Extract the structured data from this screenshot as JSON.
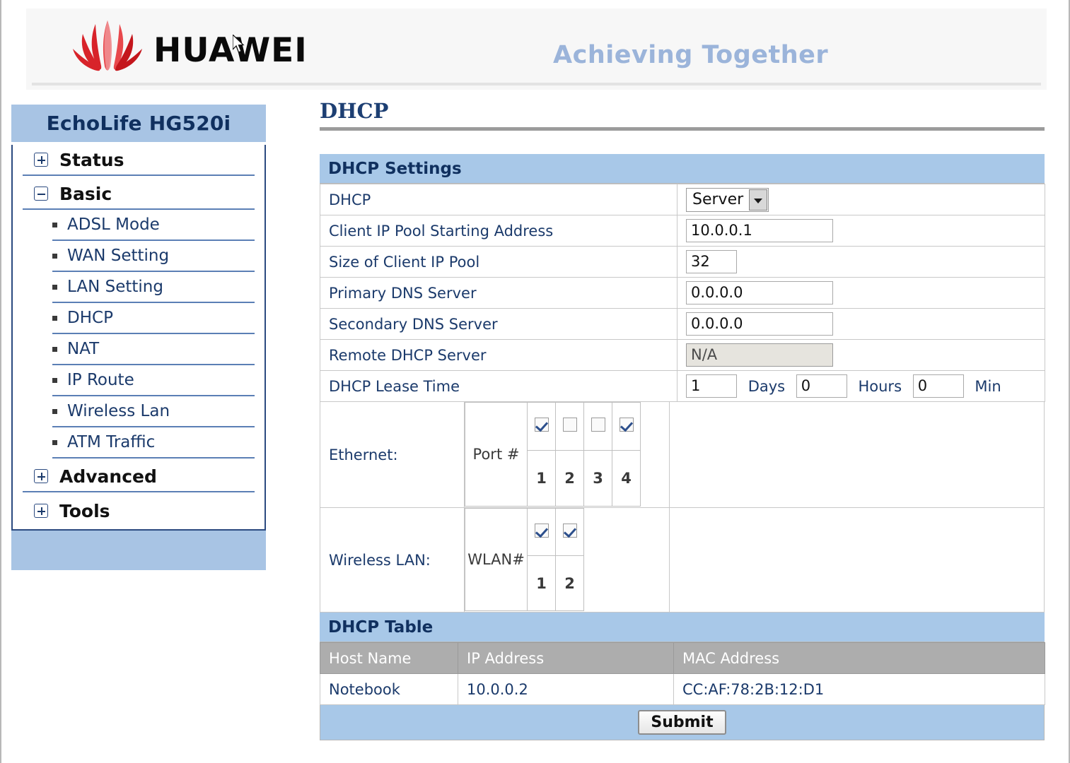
{
  "header": {
    "brand": "HUAWEI",
    "tagline": "Achieving Together",
    "logo_color": "#d8232a"
  },
  "sidebar": {
    "title": "EchoLife HG520i",
    "groups": [
      {
        "label": "Status",
        "state": "collapsed",
        "icon": "plus-box-icon"
      },
      {
        "label": "Basic",
        "state": "expanded",
        "icon": "minus-box-icon"
      }
    ],
    "basic_items": [
      {
        "label": "ADSL Mode"
      },
      {
        "label": "WAN Setting"
      },
      {
        "label": "LAN Setting"
      },
      {
        "label": "DHCP"
      },
      {
        "label": "NAT"
      },
      {
        "label": "IP Route"
      },
      {
        "label": "Wireless Lan"
      },
      {
        "label": "ATM Traffic"
      }
    ],
    "groups_after": [
      {
        "label": "Advanced",
        "state": "collapsed",
        "icon": "plus-box-icon"
      },
      {
        "label": "Tools",
        "state": "collapsed",
        "icon": "plus-box-icon"
      }
    ],
    "accent_color": "#a8c4e4",
    "border_color": "#2b4a80"
  },
  "main": {
    "page_title": "DHCP",
    "settings_header": "DHCP Settings",
    "rows": {
      "dhcp_label": "DHCP",
      "dhcp_mode_value": "Server",
      "pool_start_label": "Client IP Pool Starting Address",
      "pool_start_value": "10.0.0.1",
      "pool_size_label": "Size of Client IP Pool",
      "pool_size_value": "32",
      "primary_dns_label": "Primary DNS Server",
      "primary_dns_value": "0.0.0.0",
      "secondary_dns_label": "Secondary DNS Server",
      "secondary_dns_value": "0.0.0.0",
      "remote_dhcp_label": "Remote DHCP Server",
      "remote_dhcp_value": "N/A",
      "lease_label": "DHCP Lease Time",
      "lease_days_value": "1",
      "lease_days_unit": "Days",
      "lease_hours_value": "0",
      "lease_hours_unit": "Hours",
      "lease_min_value": "0",
      "lease_min_unit": "Min"
    },
    "ethernet": {
      "label": "Ethernet:",
      "port_label": "Port #",
      "ports": [
        {
          "num": "1",
          "checked": true
        },
        {
          "num": "2",
          "checked": false
        },
        {
          "num": "3",
          "checked": false
        },
        {
          "num": "4",
          "checked": true
        }
      ]
    },
    "wireless": {
      "label": "Wireless LAN:",
      "port_label": "WLAN#",
      "ports": [
        {
          "num": "1",
          "checked": true
        },
        {
          "num": "2",
          "checked": true
        }
      ]
    },
    "dhcp_table": {
      "header": "DHCP Table",
      "columns": [
        "Host Name",
        "IP Address",
        "MAC Address"
      ],
      "rows": [
        {
          "host": "Notebook",
          "ip": "10.0.0.2",
          "mac": "CC:AF:78:2B:12:D1"
        }
      ]
    },
    "submit_label": "Submit"
  }
}
